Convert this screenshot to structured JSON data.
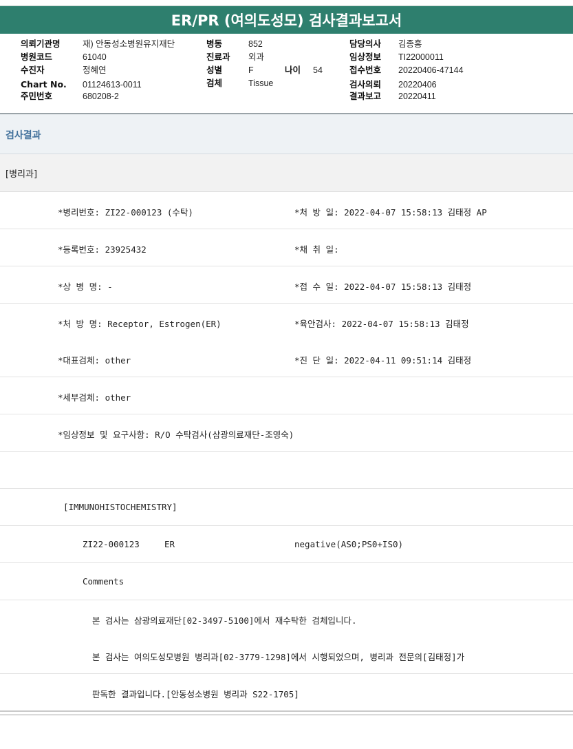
{
  "report": {
    "title": "ER/PR (여의도성모) 검사결과보고서"
  },
  "header": {
    "col1": [
      {
        "label": "의뢰기관명",
        "value": "재) 안동성소병원유지재단"
      },
      {
        "label": "병원코드",
        "value": "61040"
      },
      {
        "label": "수진자",
        "value": "정혜연"
      },
      {
        "label": "Chart No.",
        "value": "01124613-0011"
      },
      {
        "label": "주민번호",
        "value": "680208-2"
      }
    ],
    "col2": [
      {
        "label": "병동",
        "value": "852"
      },
      {
        "label": "진료과",
        "value": "외과"
      },
      {
        "label": "성별",
        "value": "F"
      },
      {
        "label": "검체",
        "value": "Tissue"
      }
    ],
    "age": {
      "label": "나이",
      "value": "54"
    },
    "col3": [
      {
        "label": "담당의사",
        "value": "김종홍"
      },
      {
        "label": "임상정보",
        "value": "TI22000011"
      },
      {
        "label": "접수번호",
        "value": "20220406-47144"
      },
      {
        "label": "검사의뢰",
        "value": "20220406"
      },
      {
        "label": "결과보고",
        "value": "20220411"
      }
    ]
  },
  "section": {
    "title": "검사결과",
    "department": "[병리과]"
  },
  "rows": [
    {
      "left": "*병리번호: ZI22-000123 (수탁)",
      "right": "*처 방 일: 2022-04-07 15:58:13  김태정 AP"
    },
    {
      "left": "*등록번호: 23925432",
      "right": "*채 취 일:"
    },
    {
      "left": "*상 병 명: -",
      "right": "*접 수 일: 2022-04-07 15:58:13  김태정"
    },
    {
      "left": "*처 방 명: Receptor, Estrogen(ER)",
      "right": "*육안검사: 2022-04-07 15:58:13  김태정"
    },
    {
      "left": "*대표검체: other",
      "right": "*진 단 일: 2022-04-11 09:51:14  김태정"
    },
    {
      "left": "*세부검체: other",
      "right": ""
    },
    {
      "left": "*임상정보 및 요구사항: R/O 수탁검사(삼광의료재단-조영숙)",
      "right": ""
    },
    {
      "left": "",
      "right": ""
    }
  ],
  "ihc": {
    "heading": "[IMMUNOHISTOCHEMISTRY]",
    "path_no": "ZI22-000123",
    "marker": "ER",
    "result": "negative(AS0;PS0+IS0)",
    "comments_label": "Comments",
    "comment_lines": [
      "본 검사는 삼광의료재단[02-3497-5100]에서 재수탁한 검체입니다.",
      "본 검사는 여의도성모병원 병리과[02-3779-1298]에서 시행되었으며, 병리과 전문의[김태정]가",
      "판독한 결과입니다.[안동성소병원 병리과 S22-1705]"
    ]
  }
}
